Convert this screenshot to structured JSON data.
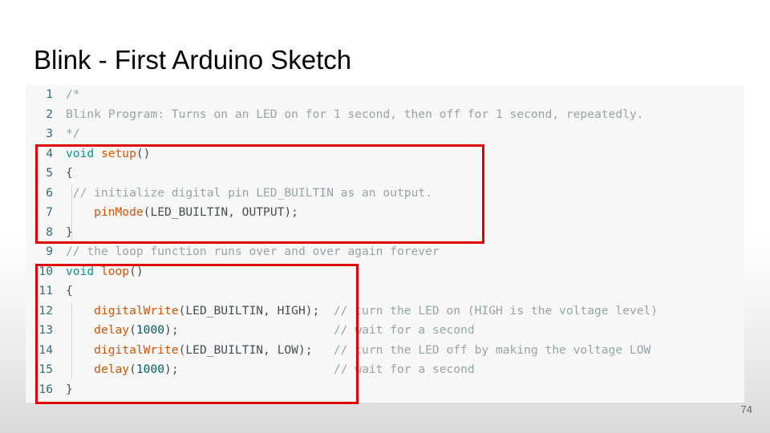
{
  "slide": {
    "title": "Blink - First Arduino Sketch",
    "page_number": "74"
  },
  "code": {
    "lines": [
      {
        "n": "1",
        "tokens": [
          {
            "t": "/*",
            "c": "cm"
          }
        ]
      },
      {
        "n": "2",
        "tokens": [
          {
            "t": "Blink Program: Turns on an LED on for 1 second, then off for 1 second, repeatedly.",
            "c": "cm"
          }
        ]
      },
      {
        "n": "3",
        "tokens": [
          {
            "t": "*/",
            "c": "cm"
          }
        ]
      },
      {
        "n": "4",
        "tokens": [
          {
            "t": "void",
            "c": "kw"
          },
          {
            "t": " ",
            "c": "tx"
          },
          {
            "t": "setup",
            "c": "fn"
          },
          {
            "t": "()",
            "c": "tx"
          }
        ]
      },
      {
        "n": "5",
        "tokens": [
          {
            "t": "{",
            "c": "tx"
          }
        ]
      },
      {
        "n": "6",
        "tokens": [
          {
            "t": " // initialize digital pin LED_BUILTIN as an output.",
            "c": "cm"
          }
        ]
      },
      {
        "n": "7",
        "tokens": [
          {
            "t": "    ",
            "c": "tx"
          },
          {
            "t": "pinMode",
            "c": "fn"
          },
          {
            "t": "(LED_BUILTIN, OUTPUT);",
            "c": "tx"
          }
        ]
      },
      {
        "n": "8",
        "tokens": [
          {
            "t": "}",
            "c": "tx"
          }
        ]
      },
      {
        "n": "9",
        "tokens": [
          {
            "t": "// the loop function runs over and over again forever",
            "c": "cm"
          }
        ]
      },
      {
        "n": "10",
        "tokens": [
          {
            "t": "void",
            "c": "kw"
          },
          {
            "t": " ",
            "c": "tx"
          },
          {
            "t": "loop",
            "c": "fn"
          },
          {
            "t": "()",
            "c": "tx"
          }
        ]
      },
      {
        "n": "11",
        "tokens": [
          {
            "t": "{",
            "c": "tx"
          }
        ]
      },
      {
        "n": "12",
        "tokens": [
          {
            "t": "    ",
            "c": "tx"
          },
          {
            "t": "digitalWrite",
            "c": "fn"
          },
          {
            "t": "(LED_BUILTIN, HIGH);",
            "c": "tx"
          },
          {
            "t": "  // turn the LED on (HIGH is the voltage level)",
            "c": "cm"
          }
        ]
      },
      {
        "n": "13",
        "tokens": [
          {
            "t": "    ",
            "c": "tx"
          },
          {
            "t": "delay",
            "c": "fn"
          },
          {
            "t": "(",
            "c": "tx"
          },
          {
            "t": "1000",
            "c": "num"
          },
          {
            "t": ");",
            "c": "tx"
          },
          {
            "t": "                      // wait for a second",
            "c": "cm"
          }
        ]
      },
      {
        "n": "14",
        "tokens": [
          {
            "t": "    ",
            "c": "tx"
          },
          {
            "t": "digitalWrite",
            "c": "fn"
          },
          {
            "t": "(LED_BUILTIN, LOW);",
            "c": "tx"
          },
          {
            "t": "   // turn the LED off by making the voltage LOW",
            "c": "cm"
          }
        ]
      },
      {
        "n": "15",
        "tokens": [
          {
            "t": "    ",
            "c": "tx"
          },
          {
            "t": "delay",
            "c": "fn"
          },
          {
            "t": "(",
            "c": "tx"
          },
          {
            "t": "1000",
            "c": "num"
          },
          {
            "t": ");",
            "c": "tx"
          },
          {
            "t": "                      // wait for a second",
            "c": "cm"
          }
        ]
      },
      {
        "n": "16",
        "tokens": [
          {
            "t": "}",
            "c": "tx"
          }
        ]
      }
    ]
  },
  "colors": {
    "keyword": "#00979d",
    "function": "#d35400",
    "number": "#005c5f",
    "comment": "#95a5a6",
    "text": "#434f54",
    "line_number": "#2b6f80",
    "highlight_border": "#e00000"
  }
}
